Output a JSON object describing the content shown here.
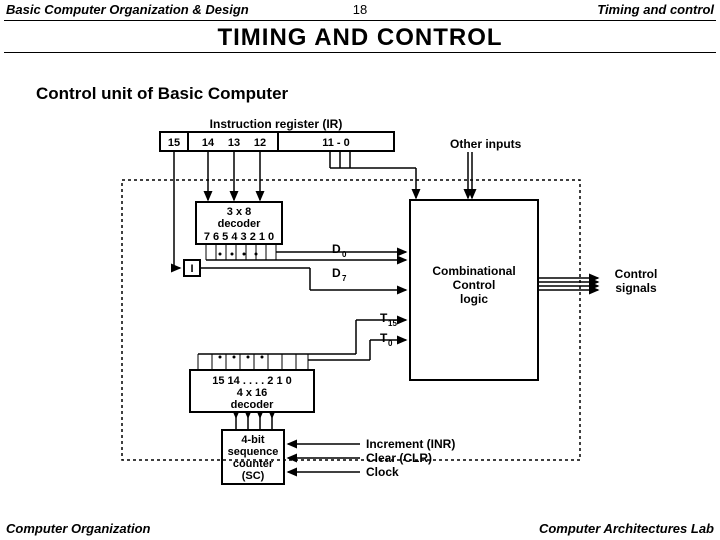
{
  "header": {
    "left": "Basic Computer Organization & Design",
    "center": "18",
    "right": "Timing and control"
  },
  "title": "TIMING  AND  CONTROL",
  "section": "Control unit of Basic Computer",
  "footer": {
    "left": "Computer Organization",
    "right": "Computer Architectures Lab"
  },
  "ir": {
    "label": "Instruction register (IR)",
    "b15": "15",
    "b14": "14",
    "b13": "13",
    "b12": "12",
    "range": "11 - 0"
  },
  "other_inputs": "Other inputs",
  "dec38": {
    "t": "3 x 8",
    "m": "decoder",
    "bits": "7  6 5 4 3 2 1 0"
  },
  "I": "I",
  "D0": "D",
  "D0s": "0",
  "D7": "D",
  "D7s": "7",
  "T15": "T",
  "T15s": "15",
  "T0": "T",
  "T0s": "0",
  "dec416": {
    "bits": "15  14  . . . .  2  1  0",
    "t": "4 x 16",
    "m": "decoder"
  },
  "sc": {
    "l1": "4-bit",
    "l2": "sequence",
    "l3": "counter",
    "l4": "(SC)"
  },
  "comb": {
    "l1": "Combinational",
    "l2": "Control",
    "l3": "logic"
  },
  "ctrl_sig": {
    "l1": "Control",
    "l2": "signals"
  },
  "sc_in": {
    "l1": "Increment (INR)",
    "l2": "Clear (CLR)",
    "l3": "Clock"
  }
}
